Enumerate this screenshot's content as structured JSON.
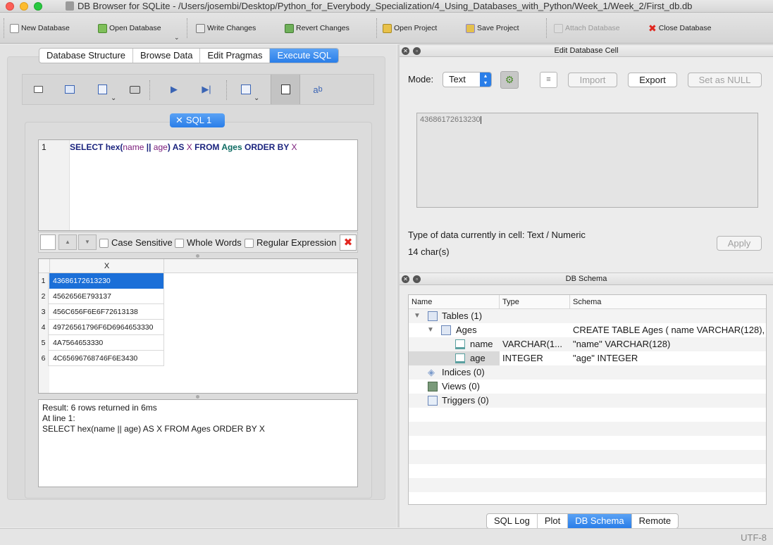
{
  "window": {
    "title": "DB Browser for SQLite - /Users/josembi/Desktop/Python_for_Everybody_Specialization/4_Using_Databases_with_Python/Week_1/Week_2/First_db.db"
  },
  "toolbar": {
    "new_database": "New Database",
    "open_database": "Open Database",
    "write_changes": "Write Changes",
    "revert_changes": "Revert Changes",
    "open_project": "Open Project",
    "save_project": "Save Project",
    "attach_database": "Attach Database",
    "close_database": "Close Database"
  },
  "main_tabs": [
    "Database Structure",
    "Browse Data",
    "Edit Pragmas",
    "Execute SQL"
  ],
  "sql_tab": {
    "label": "SQL 1"
  },
  "editor": {
    "line_number": "1",
    "tokens": {
      "select": "SELECT",
      "hex": "hex",
      "lparen": "(",
      "name": "name",
      "concat": " || ",
      "age": "age",
      "rparen": ")",
      "as": " AS ",
      "x1": "X",
      "from": " FROM ",
      "ages": "Ages",
      "orderby": " ORDER BY ",
      "x2": "X"
    }
  },
  "find": {
    "case_sensitive": "Case Sensitive",
    "whole_words": "Whole Words",
    "regex": "Regular Expression"
  },
  "results": {
    "column": "X",
    "rows": [
      {
        "n": "1",
        "v": "43686172613230"
      },
      {
        "n": "2",
        "v": "4562656E793137"
      },
      {
        "n": "3",
        "v": "456C656F6E6F72613138"
      },
      {
        "n": "4",
        "v": "49726561796F6D6964653330"
      },
      {
        "n": "5",
        "v": "4A7564653330"
      },
      {
        "n": "6",
        "v": "4C65696768746F6E3430"
      }
    ]
  },
  "message": {
    "line1": "Result: 6 rows returned in 6ms",
    "line2": "At line 1:",
    "line3": "SELECT hex(name || age) AS X FROM Ages ORDER BY X"
  },
  "edit_cell": {
    "title": "Edit Database Cell",
    "mode_label": "Mode:",
    "mode_value": "Text",
    "import": "Import",
    "export": "Export",
    "set_null": "Set as NULL",
    "cell_value": "43686172613230",
    "type_info": "Type of data currently in cell: Text / Numeric",
    "char_count": "14 char(s)",
    "apply": "Apply"
  },
  "schema": {
    "title": "DB Schema",
    "headers": [
      "Name",
      "Type",
      "Schema"
    ],
    "tables": "Tables (1)",
    "ages": {
      "name": "Ages",
      "schema": "CREATE TABLE Ages ( name VARCHAR(128),"
    },
    "col_name": {
      "name": "name",
      "type": "VARCHAR(1...",
      "schema": "\"name\" VARCHAR(128)"
    },
    "col_age": {
      "name": "age",
      "type": "INTEGER",
      "schema": "\"age\" INTEGER"
    },
    "indices": "Indices (0)",
    "views": "Views (0)",
    "triggers": "Triggers (0)"
  },
  "bottom_tabs": [
    "SQL Log",
    "Plot",
    "DB Schema",
    "Remote"
  ],
  "status": {
    "encoding": "UTF-8"
  },
  "colors": {
    "accent": "#2a7ee8",
    "selection": "#1b6fd8",
    "keyword": "#1a237e"
  }
}
